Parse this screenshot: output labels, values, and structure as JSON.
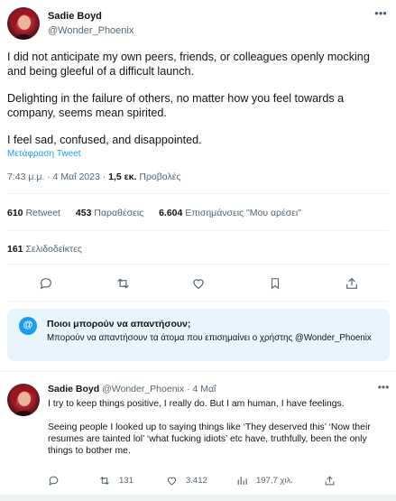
{
  "tweet": {
    "author_name": "Sadie Boyd",
    "author_handle": "@Wonder_Phoenix",
    "paragraphs": [
      "I did not anticipate my own peers, friends, or colleagues openly mocking and being gleeful of a difficult launch.",
      "Delighting in the failure of others, no matter how you feel towards a company, seems mean spirited.",
      "I feel sad, confused, and disappointed."
    ],
    "translate_label": "Μετάφραση Tweet",
    "time": "7:43 μ.μ.",
    "date": "4 Μαΐ 2023",
    "views_count": "1,5 εκ.",
    "views_label": "Προβολές",
    "separator": "·",
    "stats": {
      "retweets_count": "610",
      "retweets_label": "Retweet",
      "quotes_count": "453",
      "quotes_label": "Παραθέσεις",
      "likes_count": "6.604",
      "likes_label": "Επισημάνσεις \"Μου αρέσει\"",
      "bookmarks_count": "161",
      "bookmarks_label": "Σελιδοδείκτες"
    }
  },
  "reply_restriction": {
    "icon": "@",
    "title": "Ποιοι μπορούν να απαντήσουν;",
    "text": "Μπορούν να απαντήσουν τα άτομα που επισημαίνει ο χρήστης @Wonder_Phoenix"
  },
  "reply": {
    "author_name": "Sadie Boyd",
    "author_handle": "@Wonder_Phoenix",
    "separator": "·",
    "time": "4 Μαΐ",
    "paragraphs": [
      "I try to keep things positive, I really do. But I am human, I have feelings.",
      "Seeing people I looked up to saying things like ‘They deserved this’ ‘Now their resumes are tainted lol’ ‘what fucking idiots’ etc have, truthfully, been the only things to bother me."
    ],
    "retweets": "131",
    "likes": "3.412",
    "views": "197,7 χιλ."
  },
  "colors": {
    "accent": "#1d9bf0",
    "text_primary": "#0f1419",
    "text_secondary": "#536471",
    "reply_box_bg": "#e8f5fd",
    "divider": "#eff3f4"
  }
}
